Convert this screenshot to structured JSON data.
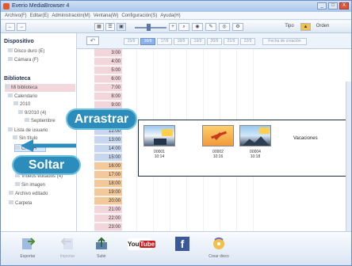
{
  "window": {
    "title": "Everio MediaBrowser 4",
    "buttons": [
      "_",
      "□",
      "X"
    ]
  },
  "menu": [
    "Archivo(F)",
    "Editar(E)",
    "Administración(M)",
    "Ventana(W)",
    "Configuración(S)",
    "Ayuda(H)"
  ],
  "toolbar": {
    "left_buttons": [
      "←",
      "→"
    ],
    "right_labels": [
      "Tipo",
      "Orden"
    ]
  },
  "sidebar": {
    "device_header": "Dispositivo",
    "devices": [
      "Disco duro (E)",
      "Cámara (F)"
    ],
    "library_header": "Biblioteca",
    "library_items": [
      "Mi biblioteca",
      "Calendario",
      "2010",
      "9/2010 (4)",
      "Septiembre",
      "Lista de usuario",
      "Sin título",
      "CHICH",
      "Vídeos editados (4)",
      "Sin imagen",
      "Archivo editado",
      "Carpeta"
    ]
  },
  "calendar": {
    "active_tab": "19/9",
    "tabs": [
      "15/9",
      "16/9",
      "17/9",
      "18/9",
      "19/9",
      "20/9",
      "21/9",
      "22/9"
    ],
    "wide_tab": "Fecha de creación",
    "times": [
      "3:00",
      "4:00",
      "5:00",
      "6:00",
      "7:00",
      "8:00",
      "9:00",
      "10:00",
      "11:00",
      "12:00",
      "13:00",
      "14:00",
      "15:00",
      "16:00",
      "17:00",
      "18:00",
      "19:00",
      "20:00",
      "21:00",
      "22:00",
      "23:00"
    ],
    "category_label": "Vacaciones"
  },
  "media": [
    {
      "id": "00001",
      "time": "10:14"
    },
    {
      "id": "00002",
      "time": "10:16"
    },
    {
      "id": "00004",
      "time": "10:18"
    }
  ],
  "labels": {
    "arrastrar": "Arrastrar",
    "soltar": "Soltar"
  },
  "bottom": {
    "buttons": [
      {
        "label": "Exportar",
        "icon": "export-icon"
      },
      {
        "label": "Importar",
        "icon": "import-icon"
      },
      {
        "label": "Subir",
        "icon": "upload-icon"
      },
      {
        "label": "YouTube",
        "icon": "youtube-icon"
      },
      {
        "label": "Facebook",
        "icon": "facebook-icon"
      },
      {
        "label": "Crear disco",
        "icon": "disc-icon"
      }
    ]
  },
  "colors": {
    "accent": "#2c8cbc",
    "selected": "#d8e8ff",
    "calendar_pink": "#f3d5dc",
    "calendar_orange": "#f3c89a",
    "calendar_blue": "#c7d7ef"
  }
}
